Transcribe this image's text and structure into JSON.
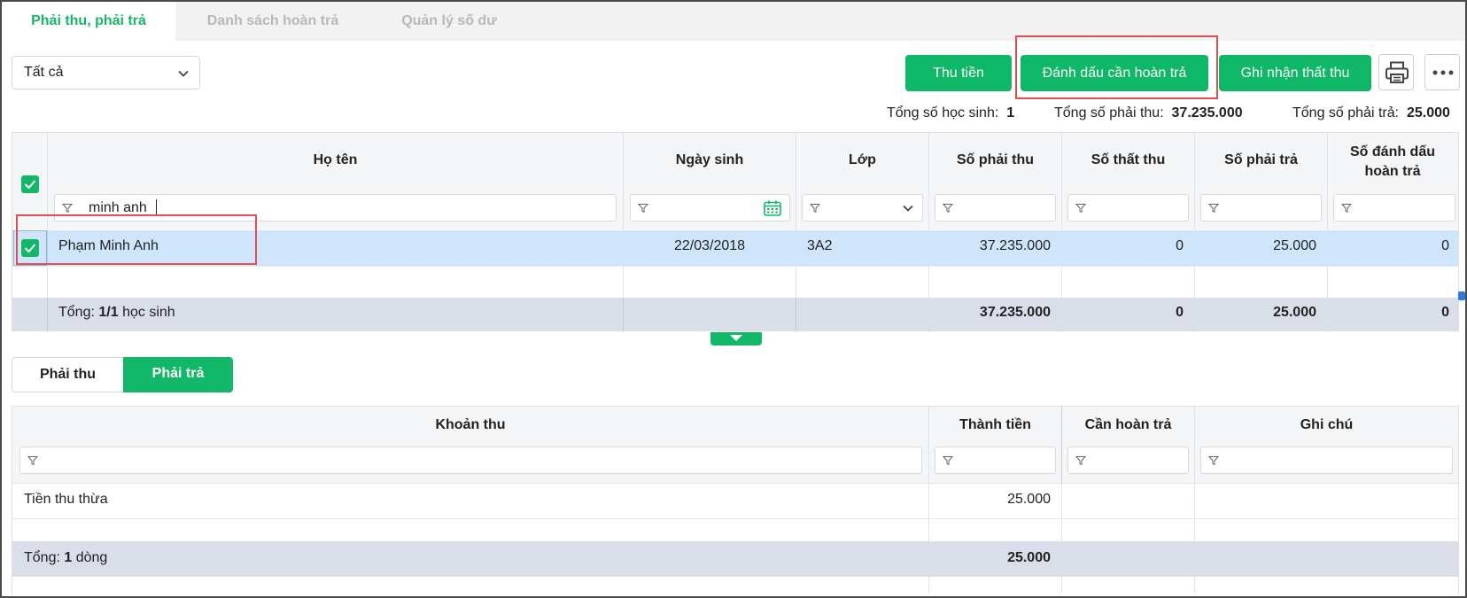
{
  "tabs": [
    {
      "label": "Phải thu, phải trả",
      "active": true
    },
    {
      "label": "Danh sách hoàn trả",
      "active": false
    },
    {
      "label": "Quản lý số dư",
      "active": false
    }
  ],
  "toolbar": {
    "filter_select": "Tất cả",
    "collect_button": "Thu tiền",
    "mark_refund_button": "Đánh dấu cần hoàn trả",
    "record_loss_button": "Ghi nhận thất thu"
  },
  "summary": {
    "students_label": "Tổng số học sinh:",
    "students_value": "1",
    "receivable_label": "Tổng số phải thu:",
    "receivable_value": "37.235.000",
    "payable_label": "Tổng số phải trả:",
    "payable_value": "25.000"
  },
  "student_grid": {
    "columns": {
      "name": "Họ tên",
      "dob": "Ngày sinh",
      "class": "Lớp",
      "receivable": "Số phải thu",
      "loss": "Số thất thu",
      "payable": "Số phải trả",
      "marked_refund": "Số đánh dấu hoàn trả"
    },
    "filters": {
      "name": "minh anh"
    },
    "rows": [
      {
        "name": "Phạm Minh Anh",
        "dob": "22/03/2018",
        "class": "3A2",
        "receivable": "37.235.000",
        "loss": "0",
        "payable": "25.000",
        "marked_refund": "0"
      }
    ],
    "total": {
      "prefix": "Tổng:",
      "count": "1/1",
      "suffix": "học sinh",
      "receivable": "37.235.000",
      "loss": "0",
      "payable": "25.000",
      "marked_refund": "0"
    }
  },
  "sub_tabs": {
    "receivable": "Phải thu",
    "payable": "Phải trả"
  },
  "detail_grid": {
    "columns": {
      "item": "Khoản thu",
      "amount": "Thành tiền",
      "refund": "Cần hoàn trả",
      "note": "Ghi chú"
    },
    "rows": [
      {
        "item": "Tiền thu thừa",
        "amount": "25.000",
        "refund": "",
        "note": ""
      }
    ],
    "total": {
      "prefix": "Tổng:",
      "count": "1",
      "suffix": "dòng",
      "amount": "25.000"
    }
  },
  "colors": {
    "accent": "#0fb866",
    "selected_row": "#cfe5fb",
    "total_row": "#d9dee8",
    "highlight": "#e05050"
  }
}
